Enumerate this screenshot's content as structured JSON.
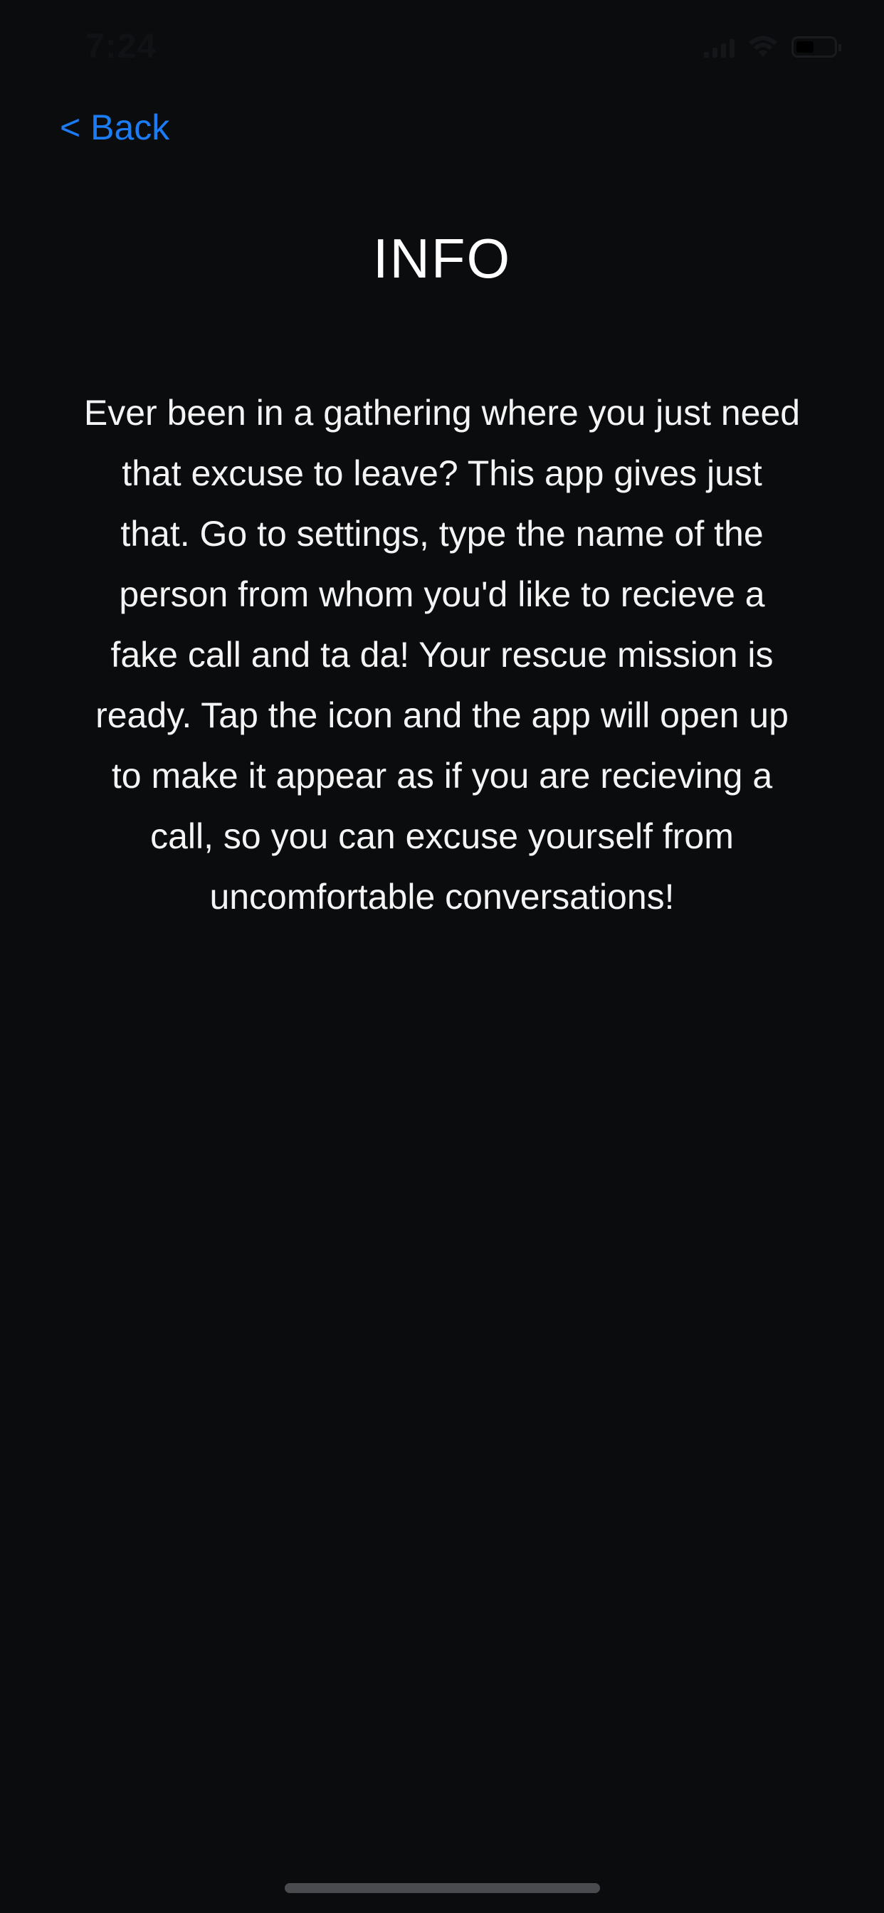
{
  "status_bar": {
    "time": "7:24",
    "icons": [
      "signal-icon",
      "wifi-icon",
      "battery-icon"
    ]
  },
  "nav": {
    "back_label": "< Back"
  },
  "page": {
    "title": "INFO",
    "body": "Ever been in a gathering where you just need that excuse to leave? This app gives just that. Go to settings, type the name of the person from whom you'd like to recieve a fake call and ta da! Your rescue mission is ready. Tap the icon and the app will open up to make it appear as if you are recieving a call, so you can excuse yourself from uncomfortable conversations!"
  },
  "colors": {
    "background": "#0b0c0e",
    "accent": "#1c7cf5",
    "text": "#ffffff"
  }
}
